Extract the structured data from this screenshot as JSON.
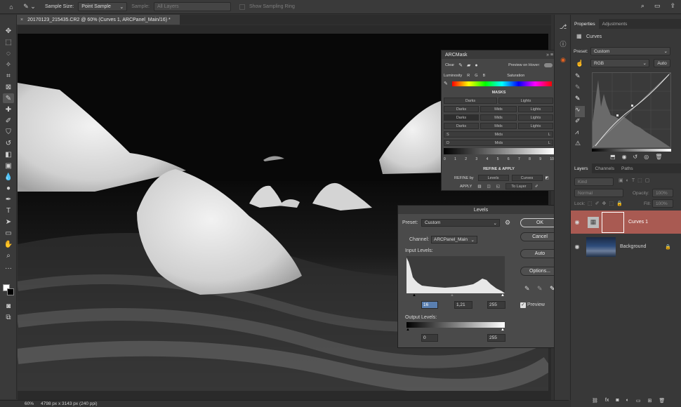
{
  "options_bar": {
    "sample_size_label": "Sample Size:",
    "sample_size_value": "Point Sample",
    "sample_label": "Sample:",
    "sample_value": "All Layers",
    "sampling_ring_label": "Show Sampling Ring"
  },
  "document_tab": {
    "title": "20170123_215435.CR2 @ 60% (Curves 1, ARCPanel_Main/16) *",
    "close": "×"
  },
  "status_bar": {
    "zoom": "60%",
    "doc_info": "4798 px x 3143 px (240 ppi)"
  },
  "properties_panel": {
    "tabs": [
      "Properties",
      "Adjustments"
    ],
    "adjustment_name": "Curves",
    "preset_label": "Preset:",
    "preset_value": "Custom",
    "channel_value": "RGB",
    "auto_label": "Auto"
  },
  "layers_panel": {
    "tabs": [
      "Layers",
      "Channels",
      "Paths"
    ],
    "kind_placeholder": "Kind",
    "blend_mode": "Normal",
    "opacity_label": "Opacity:",
    "opacity_value": "100%",
    "lock_label": "Lock:",
    "fill_label": "Fill:",
    "fill_value": "100%",
    "layers": [
      {
        "name": "Curves 1",
        "selected": true
      },
      {
        "name": "Background",
        "selected": false
      }
    ]
  },
  "arcmask": {
    "title": "ARCMask",
    "clear_label": "Clear",
    "preview_label": "Preview on Hover:",
    "luminosity_label": "Luminosity",
    "r": "R",
    "g": "G",
    "b": "B",
    "saturation_label": "Saturation",
    "masks_heading": "MASKS",
    "darks1": "Darks",
    "lights1": "Lights",
    "darks2": "Darks",
    "mids2": "Mids",
    "lights2": "Lights",
    "darks3": "Darks",
    "mids3": "Mids",
    "lights3": "Lights",
    "darks4": "Darks",
    "mids4": "Mids",
    "lights4": "Lights",
    "s_label": "S",
    "mids5": "Mids",
    "l_label": "L",
    "d_label": "D",
    "mids6": "Mids",
    "l2_label": "L",
    "scale": [
      "0",
      "1",
      "2",
      "3",
      "4",
      "5",
      "6",
      "7",
      "8",
      "9",
      "10"
    ],
    "refine_heading": "REFINE & APPLY",
    "refine_by_label": "REFINE by",
    "levels_btn": "Levels",
    "curves_btn": "Curves",
    "apply_label": "APPLY",
    "to_layer_btn": "To Layer"
  },
  "levels_dialog": {
    "title": "Levels",
    "preset_label": "Preset:",
    "preset_value": "Custom",
    "channel_label": "Channel:",
    "channel_value": "ARCPanel_Main",
    "input_levels_label": "Input Levels:",
    "input_black": "16",
    "input_gamma": "1,21",
    "input_white": "255",
    "output_levels_label": "Output Levels:",
    "output_black": "0",
    "output_white": "255",
    "ok_label": "OK",
    "cancel_label": "Cancel",
    "auto_label": "Auto",
    "options_label": "Options...",
    "preview_label": "Preview",
    "preview_checked": true
  }
}
